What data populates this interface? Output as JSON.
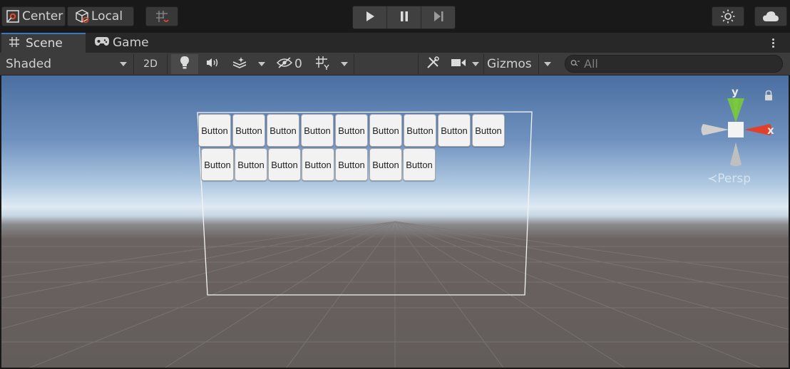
{
  "top_toolbar": {
    "pivot_label": "Center",
    "space_label": "Local",
    "play_icon": "play-icon",
    "pause_icon": "pause-icon",
    "step_icon": "step-icon"
  },
  "tabs": [
    {
      "label": "Scene",
      "icon": "hash-icon",
      "active": true
    },
    {
      "label": "Game",
      "icon": "gamepad-icon",
      "active": false
    }
  ],
  "scene_toolbar": {
    "draw_mode": "Shaded",
    "mode_2d": "2D",
    "hidden_count": "0",
    "gizmos_label": "Gizmos",
    "search_placeholder": "All"
  },
  "gizmo": {
    "y_label": "y",
    "x_label": "x",
    "view_label": "Persp"
  },
  "canvas": {
    "buttons": [
      "Button",
      "Button",
      "Button",
      "Button",
      "Button",
      "Button",
      "Button",
      "Button",
      "Button",
      "Button",
      "Button",
      "Button",
      "Button",
      "Button",
      "Button",
      "Button"
    ]
  },
  "colors": {
    "accent": "#3a79bb",
    "toolbar_bg": "#3c3c3c",
    "axis_y": "#8fd14f",
    "axis_x": "#e2402a"
  }
}
